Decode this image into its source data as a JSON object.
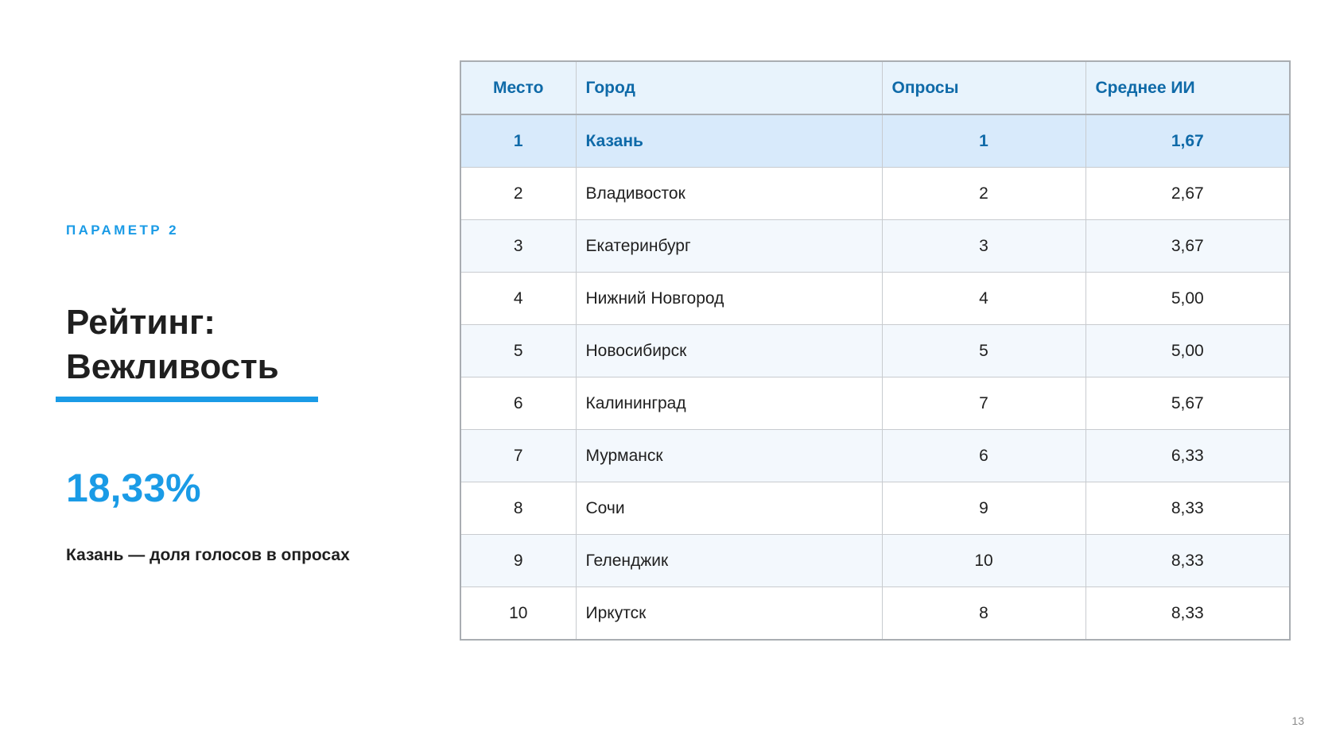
{
  "slide": {
    "parameter_label": "ПАРАМЕТР 2",
    "title_line1": "Рейтинг:",
    "title_line2": "Вежливость",
    "stat_value": "18,33%",
    "stat_caption": "Казань — доля голосов в опросах",
    "page_number": "13",
    "accent_color": "#1a9be6"
  },
  "table": {
    "headers": {
      "place": "Место",
      "city": "Город",
      "polls": "Опросы",
      "avg": "Среднее ИИ"
    },
    "rows": [
      {
        "place": "1",
        "city": "Казань",
        "polls": "1",
        "avg": "1,67",
        "highlight": true
      },
      {
        "place": "2",
        "city": "Владивосток",
        "polls": "2",
        "avg": "2,67"
      },
      {
        "place": "3",
        "city": "Екатеринбург",
        "polls": "3",
        "avg": "3,67"
      },
      {
        "place": "4",
        "city": "Нижний Новгород",
        "polls": "4",
        "avg": "5,00"
      },
      {
        "place": "5",
        "city": "Новосибирск",
        "polls": "5",
        "avg": "5,00"
      },
      {
        "place": "6",
        "city": "Калининград",
        "polls": "7",
        "avg": "5,67"
      },
      {
        "place": "7",
        "city": "Мурманск",
        "polls": "6",
        "avg": "6,33"
      },
      {
        "place": "8",
        "city": "Сочи",
        "polls": "9",
        "avg": "8,33"
      },
      {
        "place": "9",
        "city": "Геленджик",
        "polls": "10",
        "avg": "8,33"
      },
      {
        "place": "10",
        "city": "Иркутск",
        "polls": "8",
        "avg": "8,33"
      }
    ]
  }
}
